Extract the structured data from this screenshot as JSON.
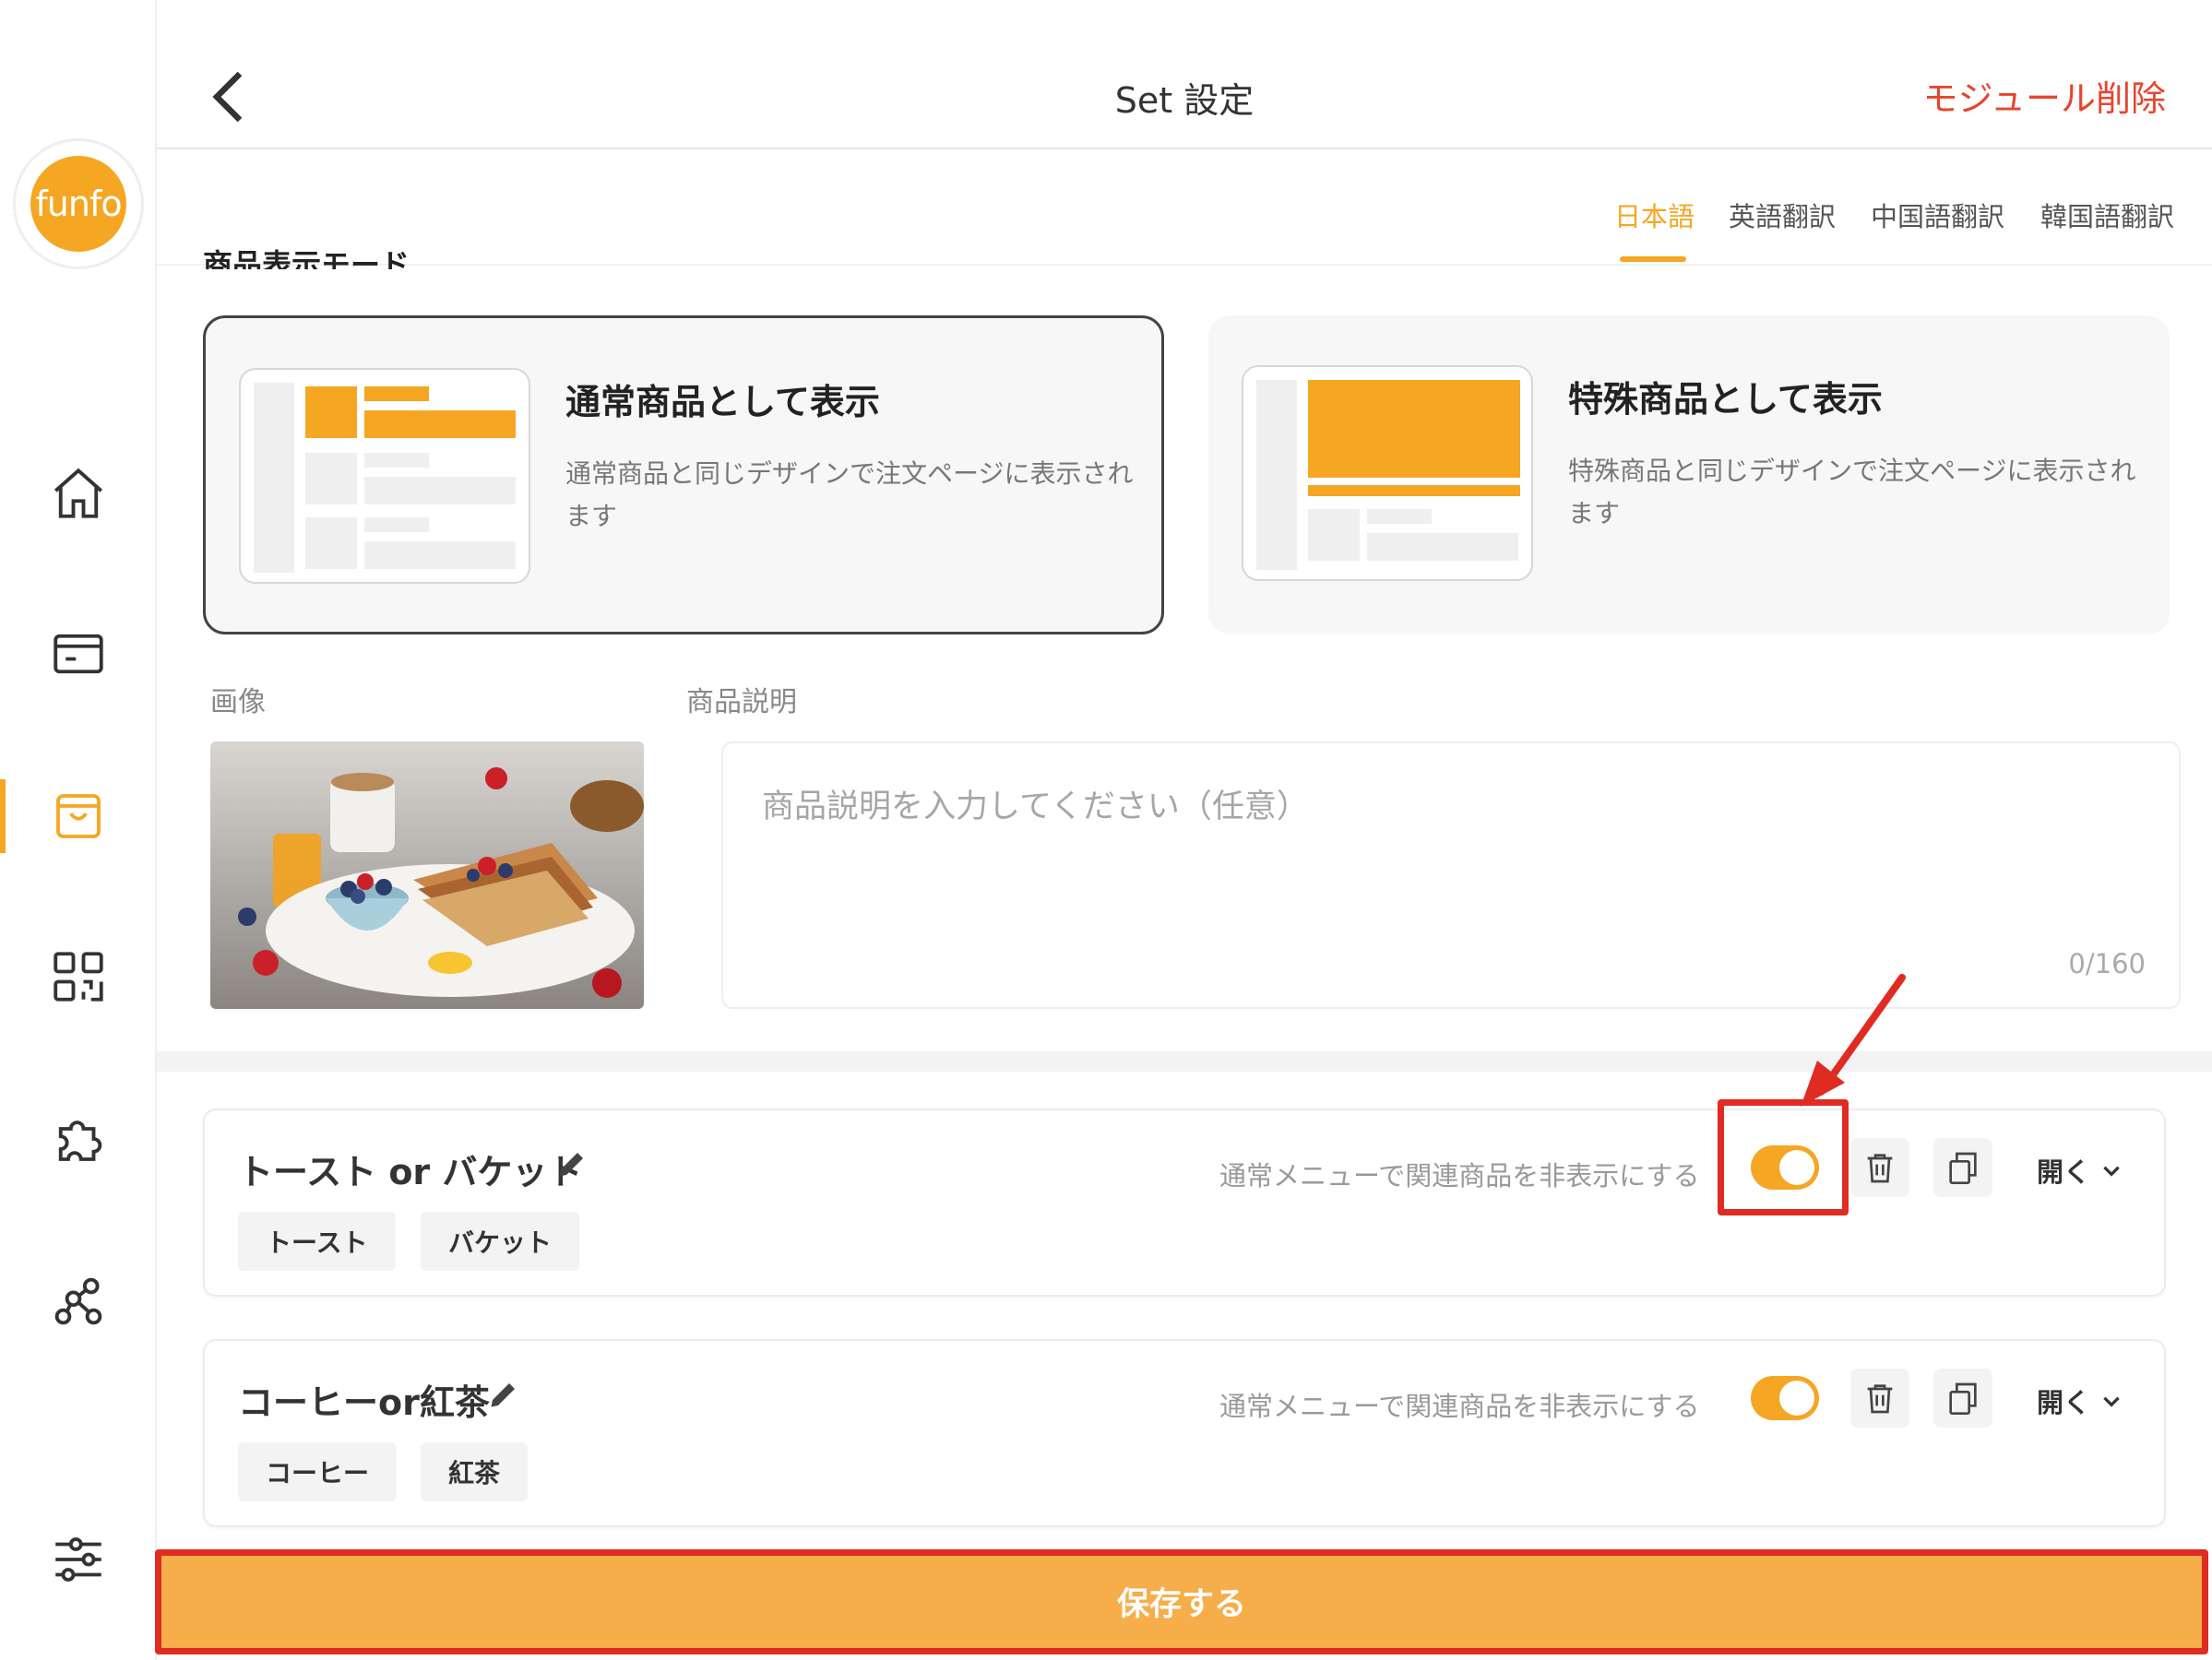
{
  "header": {
    "title": "Set 設定",
    "delete_module": "モジュール削除"
  },
  "logo": {
    "text": "funfo"
  },
  "sidebar": {
    "items": [
      {
        "icon": "home-icon"
      },
      {
        "icon": "card-icon"
      },
      {
        "icon": "shopping-bag-icon",
        "active": true
      },
      {
        "icon": "qr-code-icon"
      },
      {
        "icon": "puzzle-icon"
      },
      {
        "icon": "network-icon"
      },
      {
        "icon": "sliders-icon"
      }
    ]
  },
  "lang_tabs": [
    "日本語",
    "英語翻訳",
    "中国語翻訳",
    "韓国語翻訳"
  ],
  "section_heading": "商品表示モード",
  "modes": [
    {
      "title": "通常商品として表示",
      "description": "通常商品と同じデザインで注文ページに表示されます",
      "selected": true
    },
    {
      "title": "特殊商品として表示",
      "description": "特殊商品と同じデザインで注文ページに表示されます",
      "selected": false
    }
  ],
  "fields": {
    "image_label": "画像",
    "description_label": "商品説明",
    "description_placeholder": "商品説明を入力してください（任意）",
    "description_counter": "0/160"
  },
  "groups": [
    {
      "title": "トースト or バケット",
      "hide_label": "通常メニューで関連商品を非表示にする",
      "toggle_on": true,
      "open_label": "開く",
      "options": [
        "トースト",
        "バケット"
      ]
    },
    {
      "title": "コーヒーor紅茶",
      "hide_label": "通常メニューで関連商品を非表示にする",
      "toggle_on": true,
      "open_label": "開く",
      "options": [
        "コーヒー",
        "紅茶"
      ]
    }
  ],
  "save_button": "保存する",
  "colors": {
    "accent": "#f5a623",
    "danger": "#e8442e",
    "annotation": "#e02b23"
  }
}
